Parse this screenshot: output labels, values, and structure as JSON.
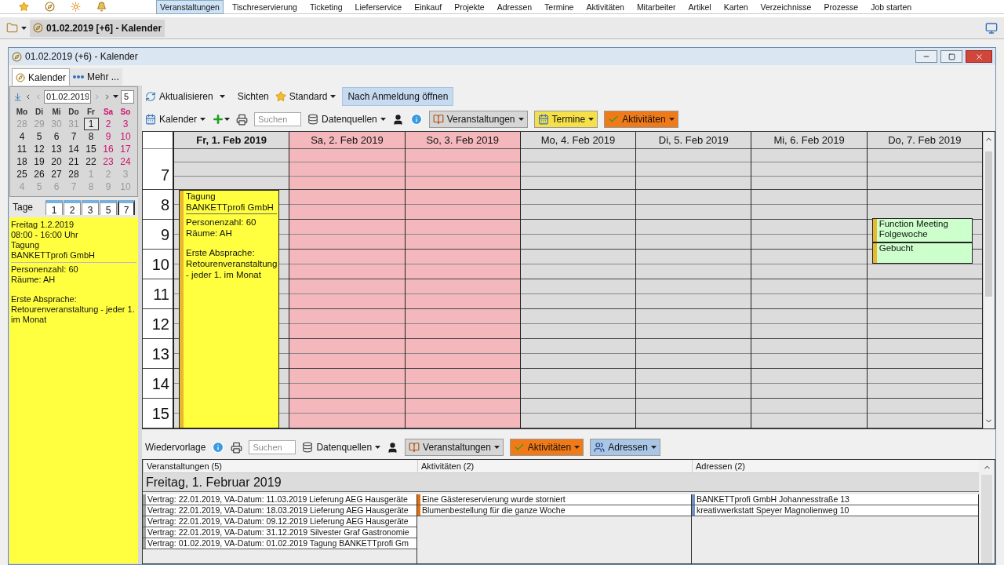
{
  "menu": {
    "items": [
      {
        "label": "Veranstaltungen",
        "selected": true
      },
      {
        "label": "Tischreservierung",
        "selected": false
      },
      {
        "label": "Ticketing",
        "selected": false
      },
      {
        "label": "Lieferservice",
        "selected": false
      },
      {
        "label": "Einkauf",
        "selected": false
      },
      {
        "label": "Projekte",
        "selected": false
      },
      {
        "label": "Adressen",
        "selected": false
      },
      {
        "label": "Termine",
        "selected": false
      },
      {
        "label": "Aktivitäten",
        "selected": false
      },
      {
        "label": "Mitarbeiter",
        "selected": false
      },
      {
        "label": "Artikel",
        "selected": false
      },
      {
        "label": "Karten",
        "selected": false
      },
      {
        "label": "Verzeichnisse",
        "selected": false
      },
      {
        "label": "Prozesse",
        "selected": false
      },
      {
        "label": "Job starten",
        "selected": false
      }
    ]
  },
  "document_tab": {
    "label": "01.02.2019 [+6] - Kalender"
  },
  "window": {
    "title": "01.02.2019 (+6) - Kalender"
  },
  "tabs": [
    {
      "label": "Kalender",
      "selected": true
    },
    {
      "label": "Mehr ...",
      "selected": false
    }
  ],
  "mini_calendar": {
    "date": "01.02.2019",
    "days_count": "5",
    "weekdays": [
      "Mo",
      "Di",
      "Mi",
      "Do",
      "Fr",
      "Sa",
      "So"
    ],
    "days": [
      {
        "label": "28",
        "muted": true,
        "selected": false
      },
      {
        "label": "29",
        "muted": true,
        "selected": false
      },
      {
        "label": "30",
        "muted": true,
        "selected": false
      },
      {
        "label": "31",
        "muted": true,
        "selected": false
      },
      {
        "label": "1",
        "muted": false,
        "selected": true
      },
      {
        "label": "2",
        "muted": false,
        "selected": false
      },
      {
        "label": "3",
        "muted": false,
        "selected": false
      },
      {
        "label": "4",
        "muted": false,
        "selected": false
      },
      {
        "label": "5",
        "muted": false,
        "selected": false
      },
      {
        "label": "6",
        "muted": false,
        "selected": false
      },
      {
        "label": "7",
        "muted": false,
        "selected": false
      },
      {
        "label": "8",
        "muted": false,
        "selected": false
      },
      {
        "label": "9",
        "muted": false,
        "selected": false
      },
      {
        "label": "10",
        "muted": false,
        "selected": false
      },
      {
        "label": "11",
        "muted": false,
        "selected": false
      },
      {
        "label": "12",
        "muted": false,
        "selected": false
      },
      {
        "label": "13",
        "muted": false,
        "selected": false
      },
      {
        "label": "14",
        "muted": false,
        "selected": false
      },
      {
        "label": "15",
        "muted": false,
        "selected": false
      },
      {
        "label": "16",
        "muted": false,
        "selected": false
      },
      {
        "label": "17",
        "muted": false,
        "selected": false
      },
      {
        "label": "18",
        "muted": false,
        "selected": false
      },
      {
        "label": "19",
        "muted": false,
        "selected": false
      },
      {
        "label": "20",
        "muted": false,
        "selected": false
      },
      {
        "label": "21",
        "muted": false,
        "selected": false
      },
      {
        "label": "22",
        "muted": false,
        "selected": false
      },
      {
        "label": "23",
        "muted": false,
        "selected": false
      },
      {
        "label": "24",
        "muted": false,
        "selected": false
      },
      {
        "label": "25",
        "muted": false,
        "selected": false
      },
      {
        "label": "26",
        "muted": false,
        "selected": false
      },
      {
        "label": "27",
        "muted": false,
        "selected": false
      },
      {
        "label": "28",
        "muted": false,
        "selected": false
      },
      {
        "label": "1",
        "muted": true,
        "selected": false
      },
      {
        "label": "2",
        "muted": true,
        "selected": false
      },
      {
        "label": "3",
        "muted": true,
        "selected": false
      },
      {
        "label": "4",
        "muted": true,
        "selected": false
      },
      {
        "label": "5",
        "muted": true,
        "selected": false
      },
      {
        "label": "6",
        "muted": true,
        "selected": false
      },
      {
        "label": "7",
        "muted": true,
        "selected": false
      },
      {
        "label": "8",
        "muted": true,
        "selected": false
      },
      {
        "label": "9",
        "muted": true,
        "selected": false
      },
      {
        "label": "10",
        "muted": true,
        "selected": false
      }
    ]
  },
  "day_range": {
    "label": "Tage",
    "buttons": [
      {
        "label": "1",
        "selected": false
      },
      {
        "label": "2",
        "selected": false
      },
      {
        "label": "3",
        "selected": false
      },
      {
        "label": "5",
        "selected": false
      },
      {
        "label": "7",
        "selected": true
      }
    ]
  },
  "details": {
    "header_lines": [
      "Freitag 1.2.2019",
      "08:00 - 16:00 Uhr",
      "Tagung",
      "BANKETTprofi GmbH"
    ],
    "paragraphs": [
      [
        "Personenzahl: 60",
        "Räume: AH"
      ],
      [
        "Erste Absprache:",
        "Retourenveranstaltung - jeder 1. im Monat"
      ]
    ]
  },
  "toolbar": {
    "refresh": "Aktualisieren",
    "views": "Sichten",
    "view": "Standard",
    "open_after_login": {
      "label": "Nach Anmeldung öffnen",
      "on": true
    }
  },
  "calendar_toolbar": {
    "calendar": "Kalender",
    "search": {
      "placeholder": "Suchen"
    },
    "sources": "Datenquellen",
    "filters": [
      {
        "label": "Veranstaltungen",
        "color": "#d6d6d6"
      },
      {
        "label": "Termine",
        "color": "#f5e04a"
      },
      {
        "label": "Aktivitäten",
        "color": "#f07a18"
      }
    ]
  },
  "grid": {
    "hours": [
      "7",
      "8",
      "9",
      "10",
      "11",
      "12",
      "13",
      "14",
      "15"
    ],
    "days": [
      {
        "label": "Fr, 1. Feb 2019",
        "selected": true,
        "weekend": false,
        "events": [
          {
            "title_lines": [
              "Tagung",
              "BANKETTprofi GmbH"
            ],
            "paragraphs": [
              [
                "Personenzahl: 60",
                "Räume: AH"
              ],
              [
                "Erste Absprache:",
                "Retourenveranstaltung - jeder 1. im Monat"
              ]
            ],
            "color": "#ffff40"
          }
        ]
      },
      {
        "label": "Sa, 2. Feb 2019",
        "selected": false,
        "weekend": true
      },
      {
        "label": "So, 3. Feb 2019",
        "selected": false,
        "weekend": true
      },
      {
        "label": "Mo, 4. Feb 2019",
        "selected": false,
        "weekend": false
      },
      {
        "label": "Di, 5. Feb 2019",
        "selected": false,
        "weekend": false
      },
      {
        "label": "Mi, 6. Feb 2019",
        "selected": false,
        "weekend": false
      },
      {
        "label": "Do, 7. Feb 2019",
        "selected": false,
        "weekend": false,
        "events": [
          {
            "title_lines": [
              "Function Meeting",
              "Folgewoche"
            ],
            "color": "#ccffcc"
          },
          {
            "title_lines": [
              "Gebucht"
            ],
            "color": "#ccffcc"
          }
        ]
      }
    ]
  },
  "followup": {
    "label": "Wiedervorlage",
    "search": {
      "placeholder": "Suchen"
    },
    "sources": "Datenquellen",
    "filters": [
      {
        "label": "Veranstaltungen",
        "color": "#d6d6d6"
      },
      {
        "label": "Aktivitäten",
        "color": "#f07a18"
      },
      {
        "label": "Adressen",
        "color": "#a9c6e6"
      }
    ],
    "group": "Freitag, 1. Februar 2019",
    "columns": [
      {
        "title": "Veranstaltungen (5)",
        "rows": [
          {
            "text": "Vertrag: 22.01.2019, VA-Datum: 11.03.2019 Lieferung AEG Hausgeräte",
            "color": "#a0a0a0"
          },
          {
            "text": "Vertrag: 22.01.2019, VA-Datum: 18.03.2019 Lieferung AEG Hausgeräte",
            "color": "#a0a0a0"
          },
          {
            "text": "Vertrag: 22.01.2019, VA-Datum: 09.12.2019 Lieferung AEG Hausgeräte",
            "color": "#a0a0a0"
          },
          {
            "text": "Vertrag: 22.01.2019, VA-Datum: 31.12.2019 Silvester Graf Gastronomie",
            "color": "#a0a0a0"
          },
          {
            "text": "Vertrag: 01.02.2019, VA-Datum: 01.02.2019 Tagung BANKETTprofi Gm",
            "color": "#a0a0a0"
          }
        ]
      },
      {
        "title": "Aktivitäten (2)",
        "rows": [
          {
            "text": "Eine Gästereservierung wurde storniert",
            "color": "#e8700c"
          },
          {
            "text": "Blumenbestellung für die ganze Woche",
            "color": "#e8700c"
          }
        ]
      },
      {
        "title": "Adressen (2)",
        "rows": [
          {
            "text": "BANKETTprofi GmbH Johannesstraße 13",
            "color": "#7090c0"
          },
          {
            "text": "kreativwerkstatt Speyer Magnolienweg 10",
            "color": "#7090c0"
          }
        ]
      }
    ]
  }
}
